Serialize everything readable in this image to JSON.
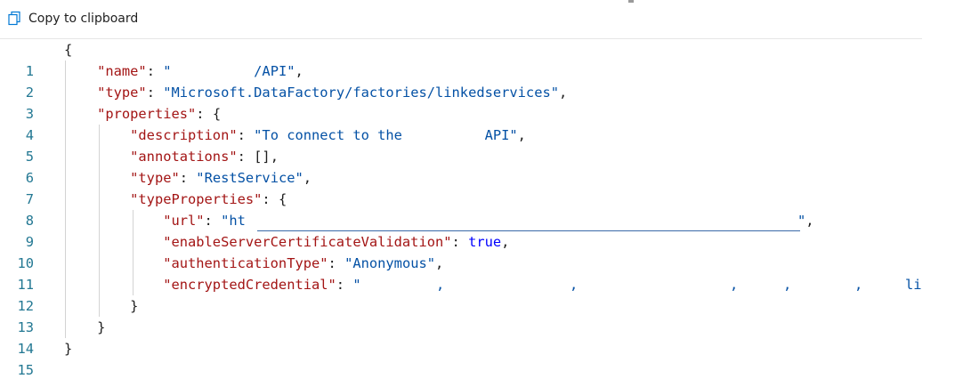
{
  "toolbar": {
    "copy_label": "Copy to clipboard"
  },
  "colors": {
    "key": "#a31515",
    "string": "#0451a5",
    "keyword": "#0000ff",
    "line_number": "#237893"
  },
  "lines": [
    {
      "n": "1"
    },
    {
      "n": "2",
      "key": "\"name\"",
      "val": "\"          /API\""
    },
    {
      "n": "3",
      "key": "\"type\"",
      "val": "\"Microsoft.DataFactory/factories/linkedservices\""
    },
    {
      "n": "4",
      "key": "\"properties\""
    },
    {
      "n": "5",
      "key": "\"description\"",
      "val": "\"To connect to the          API\""
    },
    {
      "n": "6",
      "key": "\"annotations\"",
      "val": "[]"
    },
    {
      "n": "7",
      "key": "\"type\"",
      "val": "\"RestService\""
    },
    {
      "n": "8",
      "key": "\"typeProperties\""
    },
    {
      "n": "9",
      "key": "\"url\"",
      "val_start": "\"ht",
      "val_end": "\""
    },
    {
      "n": "10",
      "key": "\"enableServerCertificateValidation\"",
      "val": "true"
    },
    {
      "n": "11",
      "key": "\"authenticationType\"",
      "val": "\"Anonymous\""
    },
    {
      "n": "12",
      "key": "\"encryptedCredential\"",
      "val": "\"",
      "val_tail": "li"
    },
    {
      "n": "13"
    },
    {
      "n": "14"
    },
    {
      "n": "15"
    }
  ]
}
